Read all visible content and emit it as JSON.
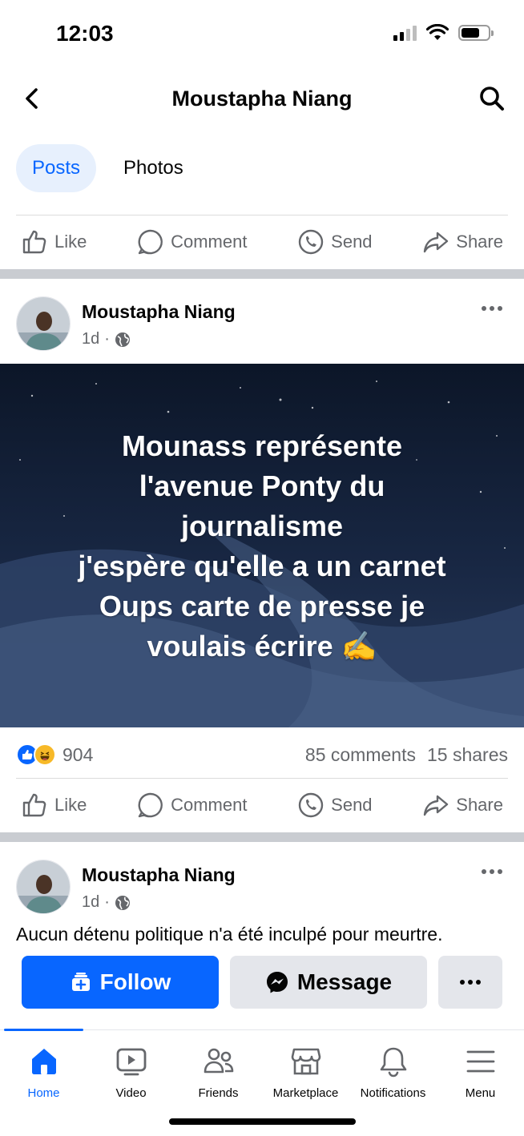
{
  "status_bar": {
    "time": "12:03",
    "icons": [
      "signal-icon",
      "wifi-icon",
      "battery-icon"
    ]
  },
  "header": {
    "title": "Moustapha Niang",
    "back_icon": "chevron-left-icon",
    "search_icon": "search-icon"
  },
  "tabs": [
    {
      "label": "Posts",
      "active": true
    },
    {
      "label": "Photos",
      "active": false
    }
  ],
  "actions": {
    "like": "Like",
    "comment": "Comment",
    "send": "Send",
    "share": "Share"
  },
  "posts": [
    {
      "author": "Moustapha Niang",
      "time": "1d",
      "separator": "·",
      "audience_icon": "globe-icon",
      "text_lines": [
        "Mounass représente",
        "l'avenue Ponty du",
        "journalisme",
        "j'espère qu'elle a un carnet",
        "Oups carte de presse je",
        "voulais écrire ✍️"
      ],
      "reaction_count": "904",
      "comments": "85 comments",
      "shares": "15 shares"
    },
    {
      "author": "Moustapha Niang",
      "time": "1d",
      "separator": "·",
      "audience_icon": "globe-icon",
      "text": "Aucun détenu politique n'a été inculpé pour meurtre."
    }
  ],
  "profile_buttons": {
    "follow": "Follow",
    "message": "Message"
  },
  "bottom_nav": [
    {
      "label": "Home",
      "icon": "home-icon",
      "active": true
    },
    {
      "label": "Video",
      "icon": "video-icon",
      "active": false
    },
    {
      "label": "Friends",
      "icon": "friends-icon",
      "active": false
    },
    {
      "label": "Marketplace",
      "icon": "marketplace-icon",
      "active": false
    },
    {
      "label": "Notifications",
      "icon": "bell-icon",
      "active": false
    },
    {
      "label": "Menu",
      "icon": "menu-icon",
      "active": false
    }
  ],
  "colors": {
    "accent": "#0866ff",
    "text": "#050505",
    "secondary_text": "#65676b",
    "separator": "#c9ccd1"
  }
}
